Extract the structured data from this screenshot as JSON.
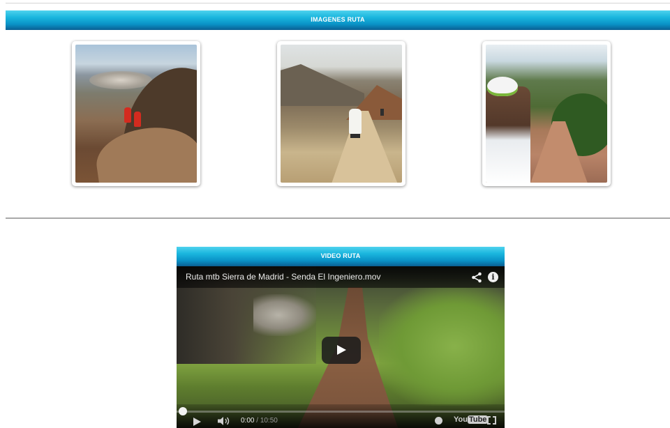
{
  "images_section": {
    "title": "IMAGENES RUTA",
    "thumbnails": [
      {
        "alt": "mtb-photo-valley"
      },
      {
        "alt": "mtb-photo-ridge"
      },
      {
        "alt": "mtb-photo-helmet"
      }
    ]
  },
  "video_section": {
    "title": "VIDEO RUTA",
    "player": {
      "video_title": "Ruta mtb Sierra de Madrid - Senda El Ingeniero.mov",
      "info_glyph": "i",
      "current_time": "0:00",
      "separator": " / ",
      "duration": "10:50",
      "progress": 0.0,
      "logo_you": "You",
      "logo_tube": "Tube",
      "accent_color": "#e52d27"
    }
  },
  "colors": {
    "bar_top": "#4fd2ee",
    "bar_bottom": "#0a5f93"
  }
}
